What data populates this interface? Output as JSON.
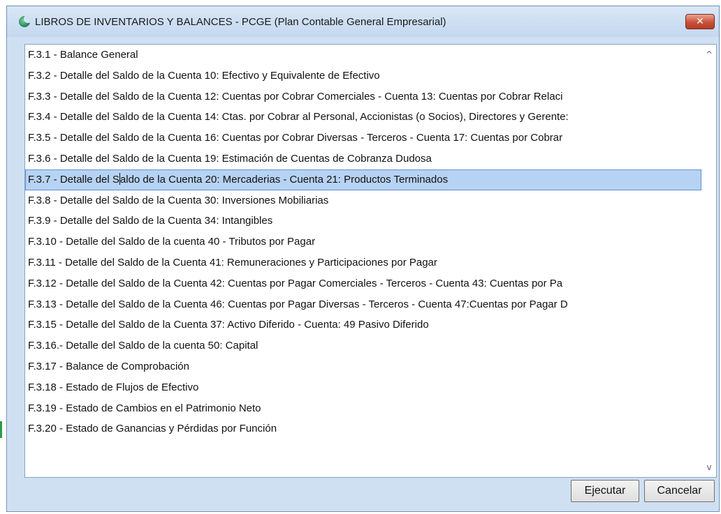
{
  "window": {
    "title": "LIBROS DE INVENTARIOS Y BALANCES - PCGE (Plan Contable General Empresarial)",
    "close_symbol": "✕",
    "app_icon": "app-logo-icon"
  },
  "list": {
    "selected_index": 6,
    "items": [
      {
        "label": "F.3.1 - Balance General"
      },
      {
        "label": "F.3.2 - Detalle del Saldo de la Cuenta 10: Efectivo y Equivalente de Efectivo"
      },
      {
        "label": "F.3.3 - Detalle del Saldo de la Cuenta 12: Cuentas por Cobrar Comerciales - Cuenta 13: Cuentas por Cobrar Relaci"
      },
      {
        "label": "F.3.4 - Detalle del Saldo de la Cuenta 14: Ctas. por Cobrar al Personal, Accionistas (o Socios), Directores y Gerente:"
      },
      {
        "label": "F.3.5 - Detalle del Saldo de la Cuenta 16: Cuentas por Cobrar Diversas - Terceros - Cuenta 17: Cuentas por Cobrar"
      },
      {
        "label": "F.3.6 - Detalle del Saldo de la Cuenta 19: Estimación de Cuentas de Cobranza Dudosa"
      },
      {
        "label_pre": "F.3.7 - Detalle del S",
        "label_post": "aldo de la Cuenta 20: Mercaderias - Cuenta 21: Productos Terminados"
      },
      {
        "label": "F.3.8 - Detalle del Saldo de la Cuenta 30: Inversiones Mobiliarias"
      },
      {
        "label": "F.3.9 - Detalle del Saldo de la Cuenta 34: Intangibles"
      },
      {
        "label": "F.3.10 - Detalle del Saldo de la cuenta 40 - Tributos por Pagar"
      },
      {
        "label": "F.3.11 - Detalle del Saldo de la Cuenta 41: Remuneraciones y Participaciones por Pagar"
      },
      {
        "label": "F.3.12 - Detalle del Saldo de la Cuenta 42: Cuentas por Pagar Comerciales - Terceros - Cuenta 43: Cuentas por Pa"
      },
      {
        "label": "F.3.13 - Detalle del Saldo de la Cuenta 46: Cuentas por Pagar Diversas - Terceros - Cuenta 47:Cuentas por Pagar D"
      },
      {
        "label": "F.3.15 - Detalle del Saldo de la Cuenta 37: Activo Diferido - Cuenta: 49 Pasivo Diferido"
      },
      {
        "label": "F.3.16.- Detalle del Saldo de la cuenta 50: Capital"
      },
      {
        "label": "F.3.17 - Balance de Comprobación"
      },
      {
        "label": "F.3.18 - Estado de Flujos de Efectivo"
      },
      {
        "label": "F.3.19 - Estado de Cambios en el Patrimonio Neto"
      },
      {
        "label": "F.3.20 - Estado de Ganancias y Pérdidas por Función"
      }
    ]
  },
  "scrollbar": {
    "up_arrow": "^",
    "down_arrow": "v"
  },
  "buttons": {
    "execute_label": "Ejecutar",
    "cancel_label": "Cancelar"
  },
  "colors": {
    "selection_bg": "#b7d3f3",
    "selection_border": "#5f8fd1",
    "close_button": "#c9503a",
    "window_frame": "#cfe0f3"
  }
}
